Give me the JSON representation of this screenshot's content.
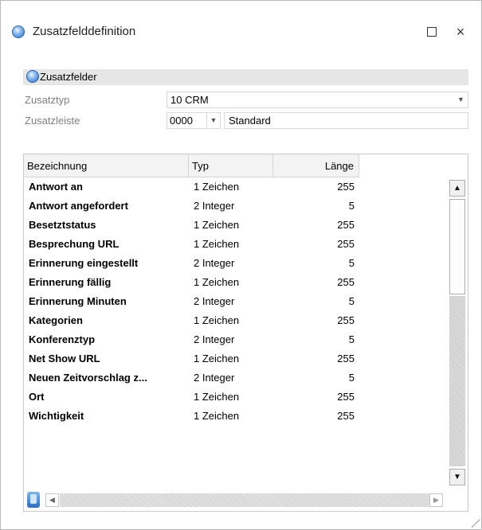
{
  "window": {
    "title": "Zusatzfelddefinition",
    "maximize_glyph": "",
    "close_glyph": "×"
  },
  "section": {
    "title": "Zusatzfelder"
  },
  "form": {
    "zusatztyp_label": "Zusatztyp",
    "zusatztyp_value": "10 CRM",
    "zusatzleiste_label": "Zusatzleiste",
    "zusatzleiste_code": "0000",
    "zusatzleiste_name": "Standard"
  },
  "table": {
    "headers": {
      "bezeichnung": "Bezeichnung",
      "typ": "Typ",
      "laenge": "Länge"
    },
    "rows": [
      {
        "bezeichnung": "Antwort an",
        "typ": "1 Zeichen",
        "laenge": "255"
      },
      {
        "bezeichnung": "Antwort angefordert",
        "typ": "2 Integer",
        "laenge": "5"
      },
      {
        "bezeichnung": "Besetztstatus",
        "typ": "1 Zeichen",
        "laenge": "255"
      },
      {
        "bezeichnung": "Besprechung URL",
        "typ": "1 Zeichen",
        "laenge": "255"
      },
      {
        "bezeichnung": "Erinnerung eingestellt",
        "typ": "2 Integer",
        "laenge": "5"
      },
      {
        "bezeichnung": "Erinnerung fällig",
        "typ": "1 Zeichen",
        "laenge": "255"
      },
      {
        "bezeichnung": "Erinnerung Minuten",
        "typ": "2 Integer",
        "laenge": "5"
      },
      {
        "bezeichnung": "Kategorien",
        "typ": "1 Zeichen",
        "laenge": "255"
      },
      {
        "bezeichnung": "Konferenztyp",
        "typ": "2 Integer",
        "laenge": "5"
      },
      {
        "bezeichnung": "Net Show URL",
        "typ": "1 Zeichen",
        "laenge": "255"
      },
      {
        "bezeichnung": "Neuen Zeitvorschlag z...",
        "typ": "2 Integer",
        "laenge": "5"
      },
      {
        "bezeichnung": "Ort",
        "typ": "1 Zeichen",
        "laenge": "255"
      },
      {
        "bezeichnung": "Wichtigkeit",
        "typ": "1 Zeichen",
        "laenge": "255"
      }
    ]
  },
  "icons": {
    "window_icon": "globe-icon",
    "section_icon": "globe-icon",
    "nav_icon": "database-icon"
  }
}
